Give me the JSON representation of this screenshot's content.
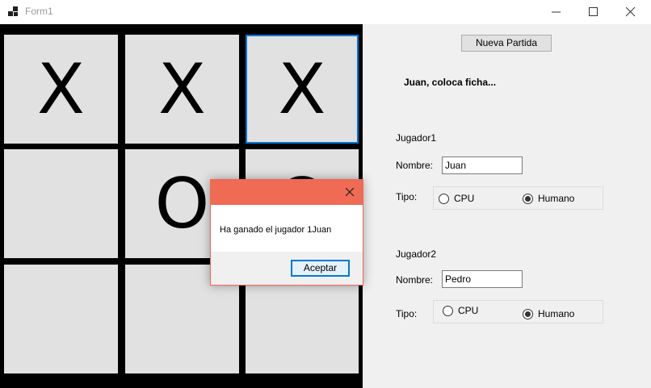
{
  "window": {
    "title": "Form1",
    "app_icon": "form-app-icon",
    "controls": [
      "minimize-icon",
      "maximize-icon",
      "close-icon"
    ]
  },
  "board": {
    "cells": [
      "X",
      "X",
      "X",
      "",
      "O",
      "O",
      "",
      "",
      ""
    ],
    "focused_cell": 2
  },
  "panel": {
    "new_game_label": "Nueva Partida",
    "status": "Juan, coloca ficha...",
    "player1": {
      "heading": "Jugador1",
      "name_label": "Nombre:",
      "name_value": "Juan",
      "type_label": "Tipo:",
      "cpu_label": "CPU",
      "human_label": "Humano",
      "selected": "Humano"
    },
    "player2": {
      "heading": "Jugador2",
      "name_label": "Nombre:",
      "name_value": "Pedro",
      "type_label": "Tipo:",
      "cpu_label": "CPU",
      "human_label": "Humano",
      "selected": "Humano"
    }
  },
  "dialog": {
    "message": "Ha ganado el jugador 1Juan",
    "ok_label": "Aceptar",
    "title_color": "#ef6b54",
    "close_icon": "close-icon"
  },
  "colors": {
    "accent": "#0078d7",
    "board_bg": "#000000",
    "cell_bg": "#e1e1e1",
    "dialog_title": "#ef6b54"
  }
}
